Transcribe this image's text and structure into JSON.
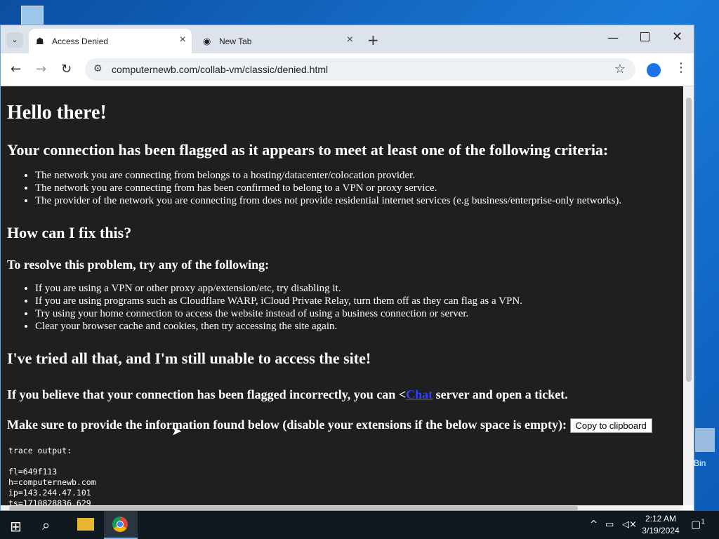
{
  "desktop": {
    "recycle_bin_label": "Bin"
  },
  "browser": {
    "tabs": [
      {
        "title": "Access Denied",
        "active": true
      },
      {
        "title": "New Tab",
        "active": false
      }
    ],
    "url": "computernewb.com/collab-vm/classic/denied.html"
  },
  "page": {
    "heading": "Hello there!",
    "subheading": "Your connection has been flagged as it appears to meet at least one of the following criteria:",
    "criteria": [
      "The network you are connecting from belongs to a hosting/datacenter/colocation provider.",
      "The network you are connecting from has been confirmed to belong to a VPN or proxy service.",
      "The provider of the network you are connecting from does not provide residential internet services (e.g business/enterprise-only networks)."
    ],
    "fix_heading": "How can I fix this?",
    "resolve_heading": "To resolve this problem, try any of the following:",
    "fixes": [
      "If you are using a VPN or other proxy app/extension/etc, try disabling it.",
      "If you are using programs such as Cloudflare WARP, iCloud Private Relay, turn them off as they can flag as a VPN.",
      "Try using your home connection to access the website instead of using a business connection or server.",
      "Clear your browser cache and cookies, then try accessing the site again."
    ],
    "tried_heading": "I've tried all that, and I'm still unable to access the site!",
    "flag_text_before": "If you believe that your connection has been flagged incorrectly, you can <",
    "flag_link": "Chat",
    "flag_text_after": " server and open a ticket.",
    "make_sure": "Make sure to provide the information found below (disable your extensions if the below space is empty):",
    "copy_button": "Copy to clipboard",
    "trace_label": "trace output:",
    "trace_lines": [
      "fl=649f113",
      "h=computernewb.com",
      "ip=143.244.47.101",
      "ts=1710828836.629"
    ]
  },
  "taskbar": {
    "time": "2:12 AM",
    "date": "3/19/2024",
    "notifications": "1"
  }
}
